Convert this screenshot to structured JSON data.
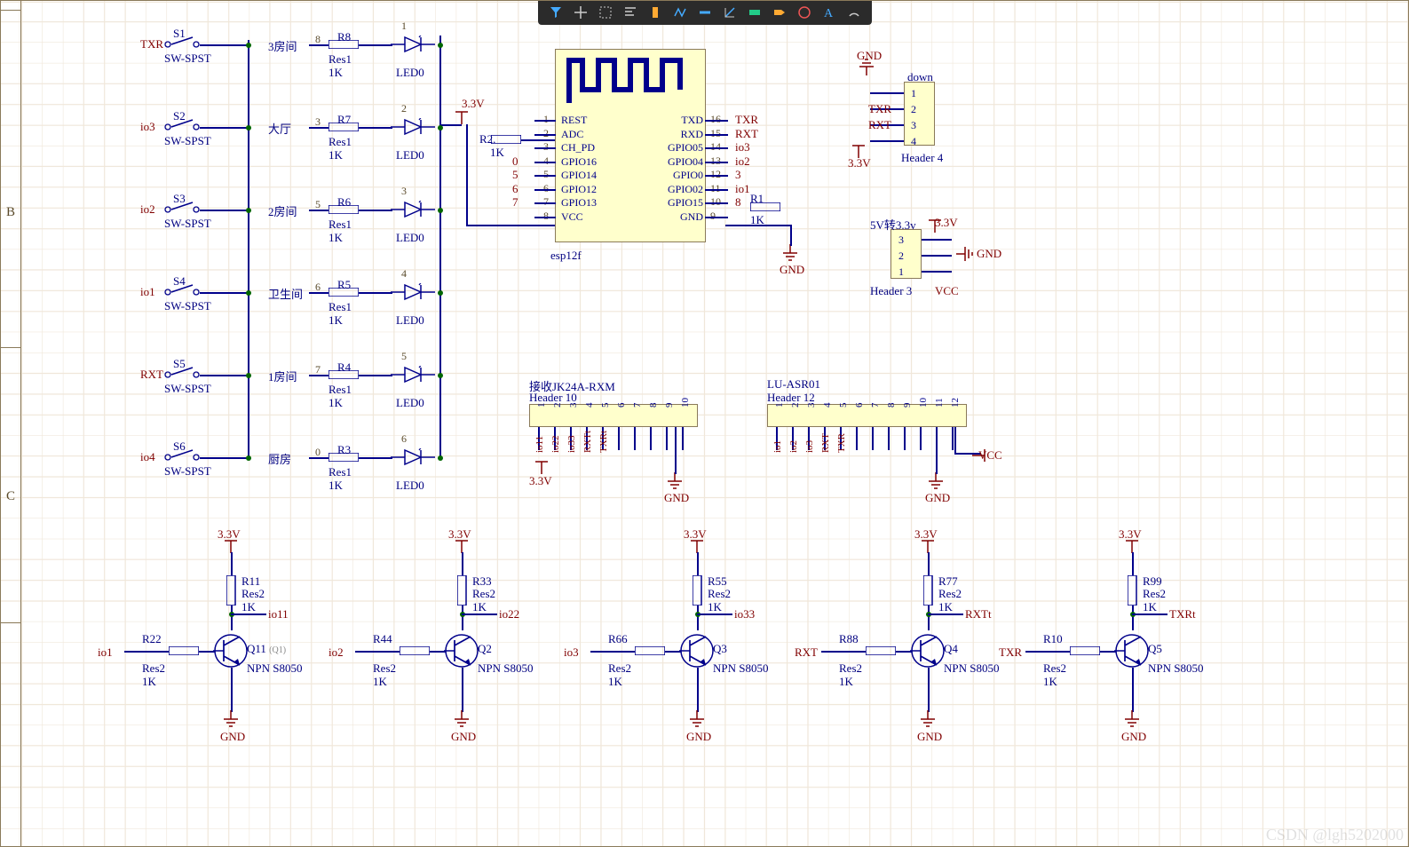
{
  "left_rows": {
    "B": "B",
    "C": "C"
  },
  "net": {
    "TXR": "TXR",
    "RXT": "RXT",
    "io1": "io1",
    "io2": "io2",
    "io3": "io3",
    "io4": "io4",
    "io11": "io11",
    "io22": "io22",
    "io33": "io33",
    "RXTt": "RXTt",
    "TXRt": "TXRt",
    "v33": "3.3V",
    "v5": "5V",
    "vcc": "VCC",
    "gnd": "GND",
    "n3": "3",
    "n8": "8",
    "R1": "R1",
    "K1": "1K"
  },
  "sw": {
    "t": "SW-SPST",
    "list": [
      {
        "id": "S1",
        "net": "TXR"
      },
      {
        "id": "S2",
        "net": "io3"
      },
      {
        "id": "S3",
        "net": "io2"
      },
      {
        "id": "S4",
        "net": "io1"
      },
      {
        "id": "S5",
        "net": "RXT"
      },
      {
        "id": "S6",
        "net": "io4"
      }
    ]
  },
  "rooms": [
    {
      "label": "3房间",
      "pin": "8",
      "r": "R8",
      "rt": "Res1",
      "rv": "1K",
      "led": "LED0",
      "ln": "1"
    },
    {
      "label": "大厅",
      "pin": "3",
      "r": "R7",
      "rt": "Res1",
      "rv": "1K",
      "led": "LED0",
      "ln": "2"
    },
    {
      "label": "2房间",
      "pin": "5",
      "r": "R6",
      "rt": "Res1",
      "rv": "1K",
      "led": "LED0",
      "ln": "3"
    },
    {
      "label": "卫生间",
      "pin": "6",
      "r": "R5",
      "rt": "Res1",
      "rv": "1K",
      "led": "LED0",
      "ln": "4"
    },
    {
      "label": "1房间",
      "pin": "7",
      "r": "R4",
      "rt": "Res1",
      "rv": "1K",
      "led": "LED0",
      "ln": "5"
    },
    {
      "label": "厨房",
      "pin": "0",
      "r": "R3",
      "rt": "Res1",
      "rv": "1K",
      "led": "LED0",
      "ln": "6"
    }
  ],
  "mcu": {
    "name": "esp12f",
    "left": [
      "REST",
      "ADC",
      "CH_PD",
      "GPIO16",
      "GPIO14",
      "GPIO12",
      "GPIO13",
      "VCC"
    ],
    "right": [
      "TXD",
      "RXD",
      "GPIO05",
      "GPIO04",
      "GPIO0",
      "GPIO02",
      "GPIO15",
      "GND"
    ],
    "lpins": [
      "1",
      "2",
      "3",
      "4",
      "5",
      "6",
      "7",
      "8"
    ],
    "rpins": [
      "16",
      "15",
      "14",
      "13",
      "12",
      "11",
      "10",
      "9"
    ],
    "rnets": [
      "TXR",
      "RXT",
      "io3",
      "io2",
      "3",
      "io1",
      "8",
      ""
    ],
    "topnet": "3.3V",
    "r2": [
      "R2.",
      "1K"
    ],
    "gnd": "GND"
  },
  "h4": {
    "title": "Header 4",
    "name": "down",
    "pins": [
      "1",
      "2",
      "3",
      "4"
    ],
    "nets": [
      "GND",
      "TXR",
      "RXT",
      "3.3V"
    ]
  },
  "h3": {
    "title": "Header 3",
    "name": "5V转3.3v",
    "pins": [
      "3",
      "2",
      "1"
    ],
    "nets": [
      "3.3V",
      "GND",
      "VCC"
    ]
  },
  "h10": {
    "title": "Header 10",
    "name": "接收JK24A-RXM",
    "pins": [
      "1",
      "2",
      "3",
      "4",
      "5",
      "6",
      "7",
      "8",
      "9",
      "10"
    ],
    "nets": [
      "io11",
      "io22",
      "io33",
      "RXTt",
      "TXRt",
      "",
      "",
      "",
      "",
      ""
    ],
    "left": "3.3V",
    "right": "GND"
  },
  "h12": {
    "title": "Header 12",
    "name": "LU-ASR01",
    "pins": [
      "1",
      "2",
      "3",
      "4",
      "5",
      "6",
      "7",
      "8",
      "9",
      "10",
      "11",
      "12"
    ],
    "nets": [
      "io1",
      "io2",
      "io3",
      "RXT",
      "TXR",
      "",
      "",
      "",
      "",
      "",
      "",
      ""
    ],
    "right": "GND",
    "rr": "VCC"
  },
  "npn": [
    {
      "id": "Q11",
      "sub": "(Q1)",
      "t": "NPN S8050",
      "rb": "R22",
      "rbv": "1K",
      "rc": "R11",
      "rcv": "1K",
      "net_in": "io1",
      "net_c": "io11",
      "top": "3.3V",
      "gnd": "GND",
      "rbt": "Res2",
      "rct": "Res2"
    },
    {
      "id": "Q2",
      "sub": "",
      "t": "NPN S8050",
      "rb": "R44",
      "rbv": "1K",
      "rc": "R33",
      "rcv": "1K",
      "net_in": "io2",
      "net_c": "io22",
      "top": "3.3V",
      "gnd": "GND",
      "rbt": "Res2",
      "rct": "Res2"
    },
    {
      "id": "Q3",
      "sub": "",
      "t": "NPN S8050",
      "rb": "R66",
      "rbv": "1K",
      "rc": "R55",
      "rcv": "1K",
      "net_in": "io3",
      "net_c": "io33",
      "top": "3.3V",
      "gnd": "GND",
      "rbt": "Res2",
      "rct": "Res2"
    },
    {
      "id": "Q4",
      "sub": "",
      "t": "NPN S8050",
      "rb": "R88",
      "rbv": "1K",
      "rc": "R77",
      "rcv": "1K",
      "net_in": "RXT",
      "net_c": "RXTt",
      "top": "3.3V",
      "gnd": "GND",
      "rbt": "Res2",
      "rct": "Res2"
    },
    {
      "id": "Q5",
      "sub": "",
      "t": "NPN S8050",
      "rb": "R10",
      "rbv": "1K",
      "rc": "R99",
      "rcv": "1K",
      "net_in": "TXR",
      "net_c": "TXRt",
      "top": "3.3V",
      "gnd": "GND",
      "rbt": "Res2",
      "rct": "Res2"
    }
  ],
  "watermark": "CSDN @lgh5202000"
}
